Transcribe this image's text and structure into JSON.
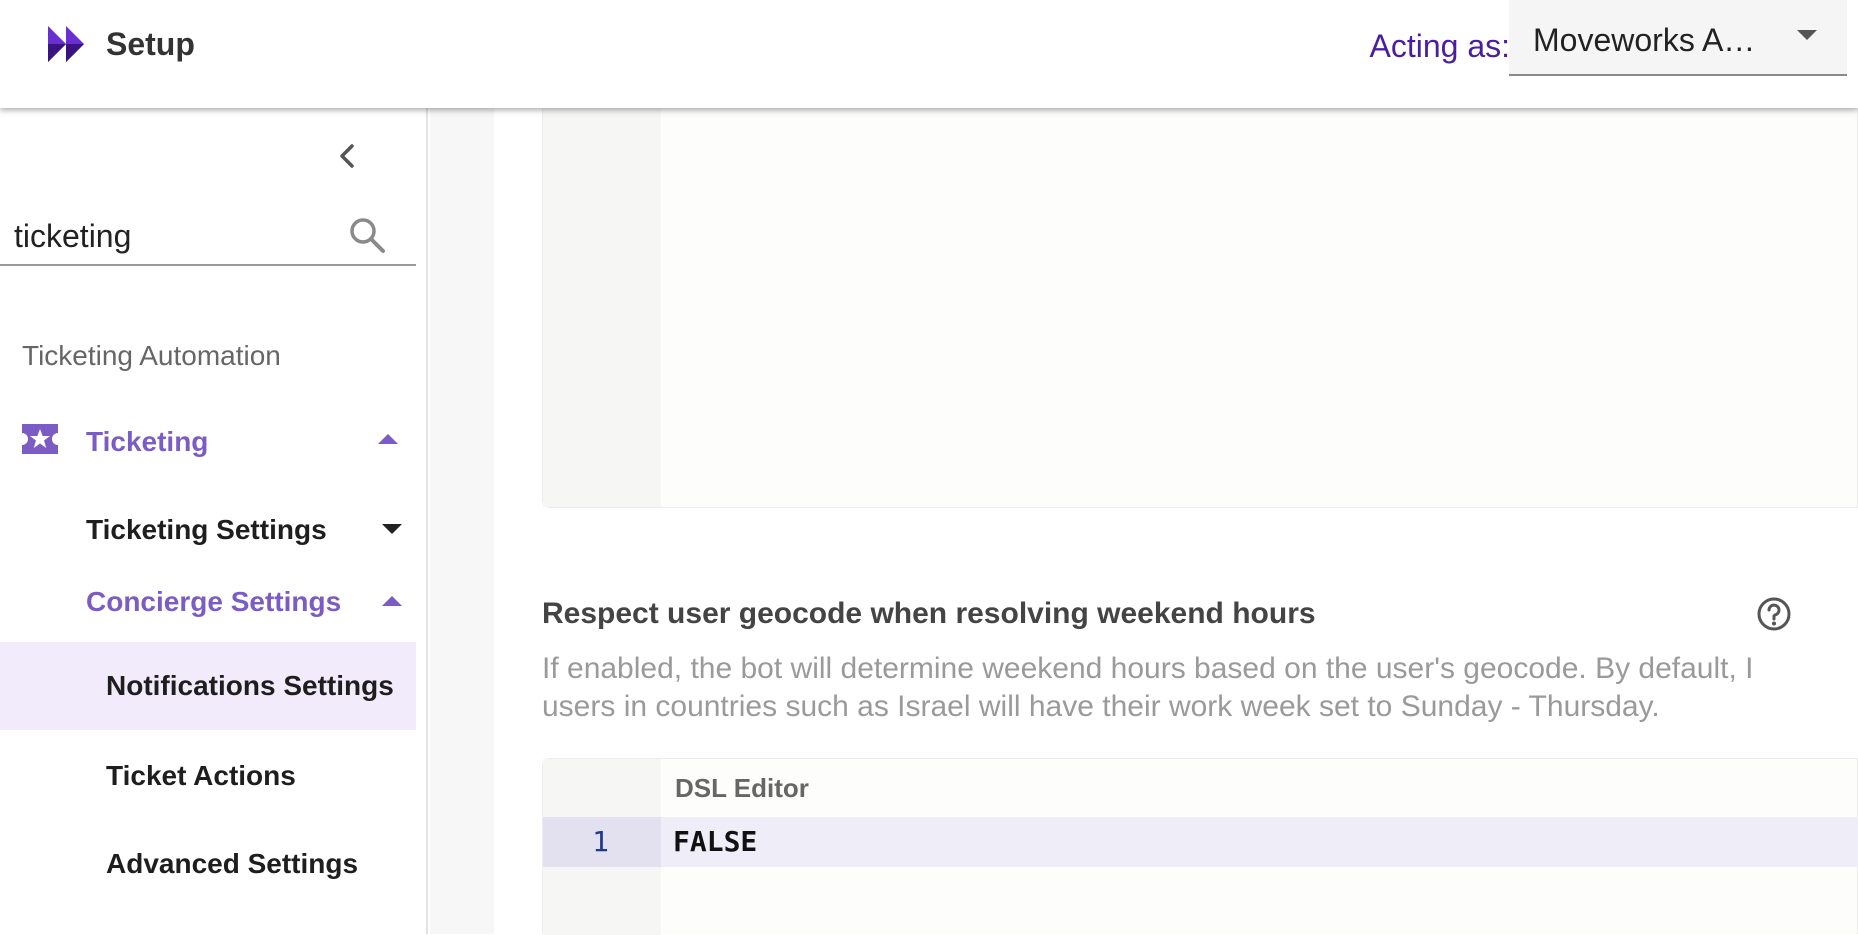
{
  "header": {
    "title": "Setup",
    "acting_as_label": "Acting as:",
    "acting_as_value": "Moveworks A…"
  },
  "sidebar": {
    "search_value": "ticketing",
    "section_heading": "Ticketing Automation",
    "items": [
      {
        "label": "Ticketing",
        "icon": "ticket-star-icon",
        "state": "expanded"
      },
      {
        "label": "Ticketing Settings",
        "state": "collapsed"
      },
      {
        "label": "Concierge Settings",
        "state": "expanded"
      },
      {
        "label": "Notifications Settings",
        "state": "selected"
      },
      {
        "label": "Ticket Actions"
      },
      {
        "label": "Advanced Settings"
      }
    ]
  },
  "main": {
    "setting_title": "Respect user geocode when resolving weekend hours",
    "setting_desc_line1": "If enabled, the bot will determine weekend hours based on the user's geocode. By default, I",
    "setting_desc_line2": "users in countries such as Israel will have their work week set to Sunday - Thursday.",
    "editor_label": "DSL Editor",
    "line_number": "1",
    "code": "FALSE"
  },
  "colors": {
    "accent": "#7a5cc4",
    "acting_as": "#4a1e9e",
    "selected_bg": "#f1ebfb"
  }
}
